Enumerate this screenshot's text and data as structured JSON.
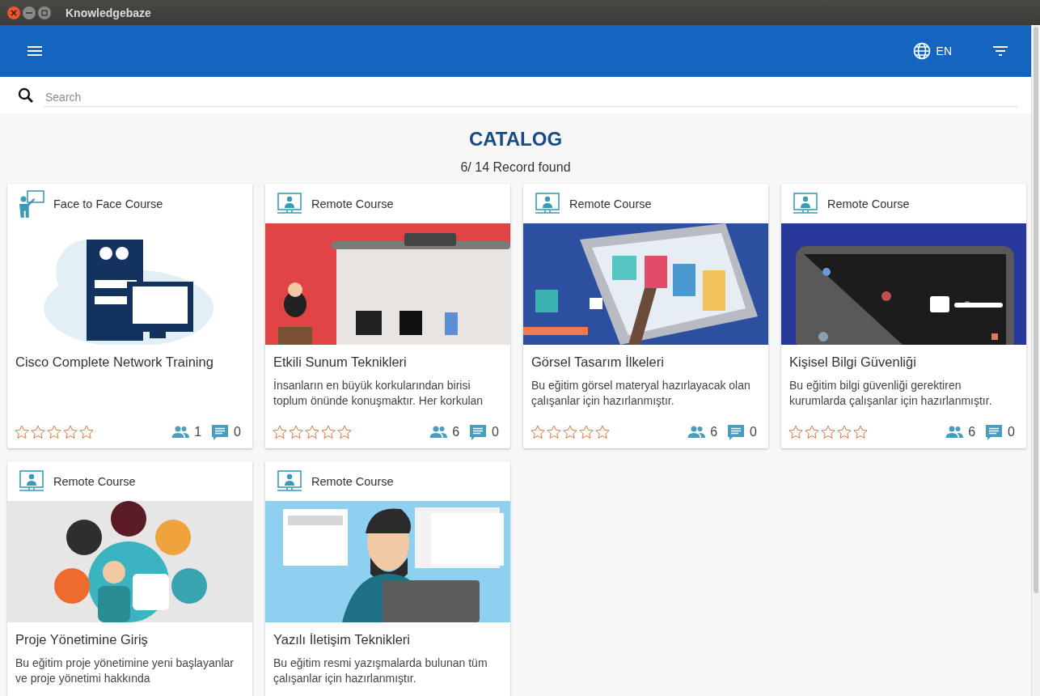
{
  "window": {
    "title": "Knowledgebaze"
  },
  "header": {
    "language": "EN"
  },
  "search": {
    "placeholder": "Search"
  },
  "catalog": {
    "title": "CATALOG",
    "record_count": "6/ 14 Record found"
  },
  "courses": [
    {
      "kind": "face_to_face",
      "type_label": "Face to Face Course",
      "title": "Cisco Complete Network Training",
      "stars": 0,
      "participants": "1",
      "comments": "0"
    },
    {
      "kind": "remote",
      "type_label": "Remote Course",
      "title": "Etkili Sunum Teknikleri",
      "description": "İnsanların en büyük korkularından birisi toplum önünde konuşmaktır. Her korkulan",
      "stars": 0,
      "participants": "6",
      "comments": "0"
    },
    {
      "kind": "remote",
      "type_label": "Remote Course",
      "title": "Görsel Tasarım İlkeleri",
      "description": "Bu eğitim görsel materyal hazırlayacak olan çalışanlar için hazırlanmıştır.",
      "stars": 0,
      "participants": "6",
      "comments": "0"
    },
    {
      "kind": "remote",
      "type_label": "Remote Course",
      "title": "Kişisel Bilgi Güvenliği",
      "description": "Bu eğitim bilgi güvenliği gerektiren kurumlarda çalışanlar için hazırlanmıştır.",
      "stars": 0,
      "participants": "6",
      "comments": "0"
    },
    {
      "kind": "remote",
      "type_label": "Remote Course",
      "title": "Proje Yönetimine Giriş",
      "description": "Bu eğitim proje yönetimine yeni başlayanlar ve proje yönetimi hakkında"
    },
    {
      "kind": "remote",
      "type_label": "Remote Course",
      "title": "Yazılı İletişim Teknikleri",
      "description": "Bu eğitim resmi yazışmalarda bulunan tüm çalışanlar için hazırlanmıştır."
    }
  ]
}
